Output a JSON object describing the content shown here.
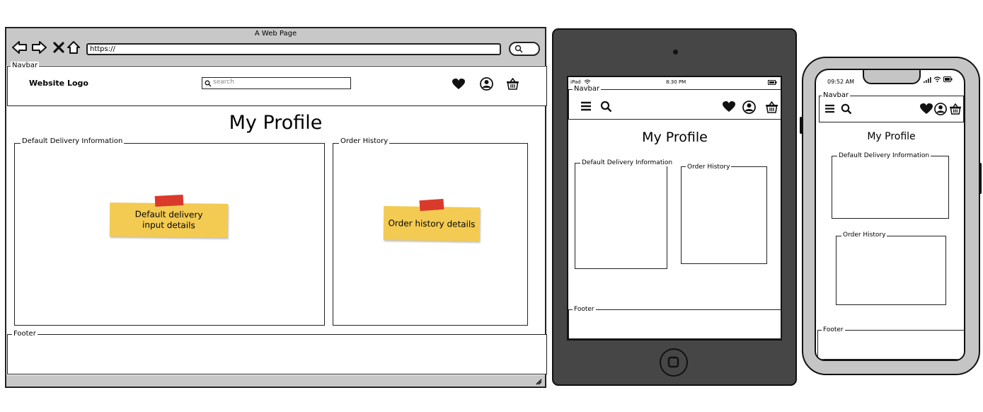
{
  "desktop": {
    "window_title": "A Web Page",
    "url": "https://",
    "navbar_label": "Navbar",
    "logo_text": "Website Logo",
    "search_placeholder": "search",
    "page_title": "My Profile",
    "delivery_panel_label": "Default Delivery Information",
    "delivery_note": "Default delivery input details",
    "order_panel_label": "Order History",
    "order_note": "Order history details",
    "footer_label": "Footer",
    "icons": [
      "back-arrow-icon",
      "forward-arrow-icon",
      "close-icon",
      "home-icon",
      "heart-icon",
      "user-icon",
      "basket-icon",
      "search-icon",
      "resize-icon"
    ]
  },
  "tablet": {
    "status_carrier": "iPad",
    "status_time": "8:30 PM",
    "navbar_label": "Navbar",
    "page_title": "My Profile",
    "delivery_panel_label": "Default Delivery Information",
    "order_panel_label": "Order History",
    "footer_label": "Footer",
    "icons": [
      "wifi-icon",
      "battery-icon",
      "menu-icon",
      "search-icon",
      "heart-icon",
      "user-icon",
      "basket-icon",
      "home-button-icon",
      "camera-icon"
    ]
  },
  "phone": {
    "status_time": "09:52 AM",
    "navbar_label": "Navbar",
    "page_title": "My Profile",
    "delivery_panel_label": "Default Delivery Information",
    "order_panel_label": "Order History",
    "footer_label": "Footer",
    "icons": [
      "signal-icon",
      "wifi-icon",
      "battery-icon",
      "menu-icon",
      "search-icon",
      "heart-icon",
      "user-icon",
      "basket-icon"
    ]
  }
}
